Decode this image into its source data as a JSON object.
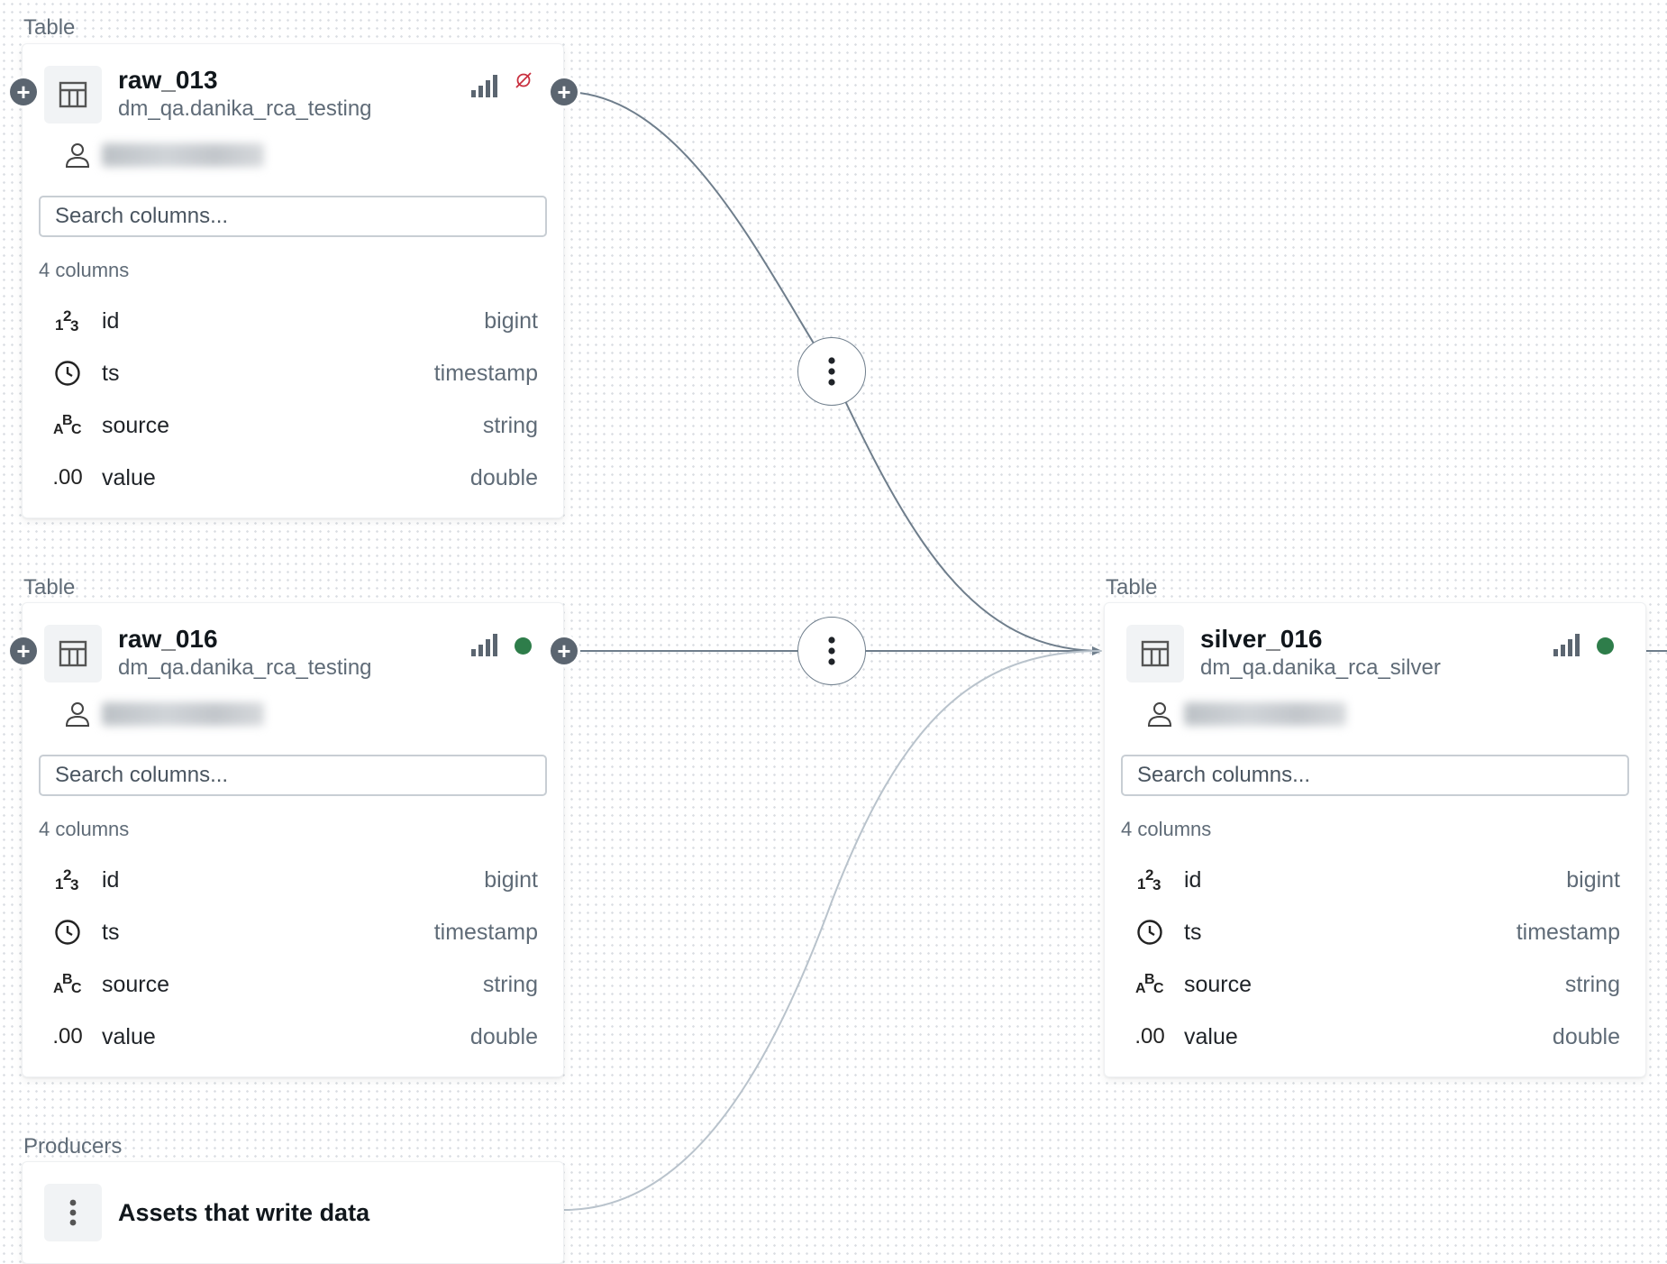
{
  "colors": {
    "edge": "#6f7e8c",
    "edge_light": "#b9c3cc",
    "status_ok": "#2e7d4a",
    "status_warn": "#c9303f"
  },
  "cards": [
    {
      "label": "Table",
      "name": "raw_013",
      "path": "dm_qa.danika_rca_testing",
      "status": "hidden",
      "search_placeholder": "Search columns...",
      "column_count": "4 columns",
      "columns": [
        {
          "icon": "integer-icon",
          "name": "id",
          "type": "bigint"
        },
        {
          "icon": "clock-icon",
          "name": "ts",
          "type": "timestamp"
        },
        {
          "icon": "string-icon",
          "name": "source",
          "type": "string"
        },
        {
          "icon": "decimal-icon",
          "name": "value",
          "type": "double"
        }
      ]
    },
    {
      "label": "Table",
      "name": "raw_016",
      "path": "dm_qa.danika_rca_testing",
      "status": "ok",
      "search_placeholder": "Search columns...",
      "column_count": "4 columns",
      "columns": [
        {
          "icon": "integer-icon",
          "name": "id",
          "type": "bigint"
        },
        {
          "icon": "clock-icon",
          "name": "ts",
          "type": "timestamp"
        },
        {
          "icon": "string-icon",
          "name": "source",
          "type": "string"
        },
        {
          "icon": "decimal-icon",
          "name": "value",
          "type": "double"
        }
      ]
    },
    {
      "label": "Table",
      "name": "silver_016",
      "path": "dm_qa.danika_rca_silver",
      "status": "ok",
      "search_placeholder": "Search columns...",
      "column_count": "4 columns",
      "columns": [
        {
          "icon": "integer-icon",
          "name": "id",
          "type": "bigint"
        },
        {
          "icon": "clock-icon",
          "name": "ts",
          "type": "timestamp"
        },
        {
          "icon": "string-icon",
          "name": "source",
          "type": "string"
        },
        {
          "icon": "decimal-icon",
          "name": "value",
          "type": "double"
        }
      ]
    }
  ],
  "producers": {
    "label": "Producers",
    "title": "Assets that write data"
  },
  "icons": {
    "plus": "+",
    "decimal": ".00",
    "integer": [
      "1",
      "2",
      "3"
    ],
    "string": [
      "A",
      "B",
      "C"
    ]
  }
}
